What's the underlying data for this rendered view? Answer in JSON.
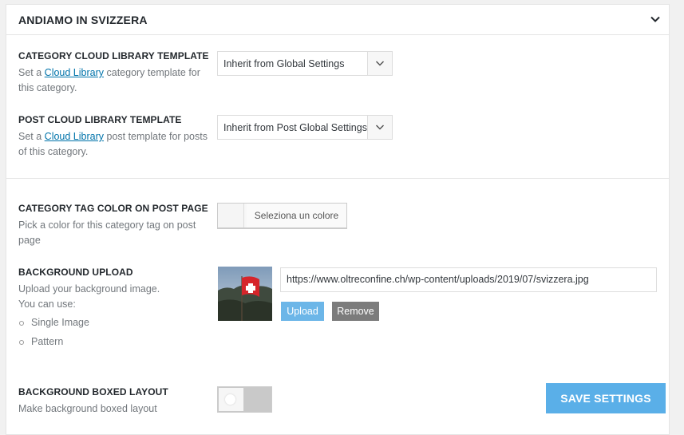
{
  "panel": {
    "title": "ANDIAMO IN SVIZZERA"
  },
  "category_template": {
    "label": "CATEGORY CLOUD LIBRARY TEMPLATE",
    "desc_prefix": "Set a ",
    "desc_link": "Cloud Library",
    "desc_suffix": " category template for this category.",
    "selected": "Inherit from Global Settings"
  },
  "post_template": {
    "label": "POST CLOUD LIBRARY TEMPLATE",
    "desc_prefix": "Set a ",
    "desc_link": "Cloud Library",
    "desc_suffix": " post template for posts of this category.",
    "selected": "Inherit from Post Global Settings"
  },
  "tag_color": {
    "label": "CATEGORY TAG COLOR ON POST PAGE",
    "desc": "Pick a color for this category tag on post page",
    "button_label": "Seleziona un colore"
  },
  "background_upload": {
    "label": "BACKGROUND UPLOAD",
    "desc_line1": "Upload your background image.",
    "desc_line2": "You can use:",
    "options": [
      "Single Image",
      "Pattern"
    ],
    "url": "https://www.oltreconfine.ch/wp-content/uploads/2019/07/svizzera.jpg",
    "upload_label": "Upload",
    "remove_label": "Remove"
  },
  "boxed_layout": {
    "label": "BACKGROUND BOXED LAYOUT",
    "desc": "Make background boxed layout",
    "enabled": false
  },
  "save_label": "SAVE SETTINGS",
  "colors": {
    "link": "#0073aa",
    "upload_button": "#6cb6e8",
    "remove_button": "#7c7c7c",
    "save_button": "#5aafe8"
  }
}
